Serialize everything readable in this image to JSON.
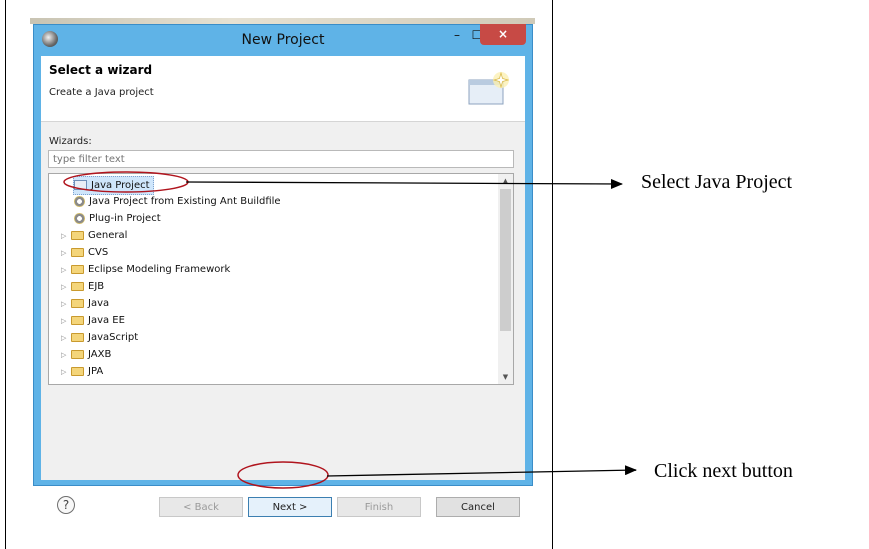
{
  "window": {
    "title": "New Project",
    "minimize_glyph": "–",
    "maximize_glyph": "☐",
    "close_glyph": "×"
  },
  "banner": {
    "title": "Select a wizard",
    "description": "Create a Java project"
  },
  "wizards": {
    "label": "Wizards:",
    "filter_placeholder": "type filter text",
    "items": [
      {
        "label": "Java Project",
        "icon": "java-project-icon"
      },
      {
        "label": "Java Project from Existing Ant Buildfile",
        "icon": "ant-project-icon"
      },
      {
        "label": "Plug-in Project",
        "icon": "plugin-project-icon"
      },
      {
        "label": "General",
        "icon": "folder-icon"
      },
      {
        "label": "CVS",
        "icon": "folder-icon"
      },
      {
        "label": "Eclipse Modeling Framework",
        "icon": "folder-icon"
      },
      {
        "label": "EJB",
        "icon": "folder-icon"
      },
      {
        "label": "Java",
        "icon": "folder-icon"
      },
      {
        "label": "Java EE",
        "icon": "folder-icon"
      },
      {
        "label": "JavaScript",
        "icon": "folder-icon"
      },
      {
        "label": "JAXB",
        "icon": "folder-icon"
      },
      {
        "label": "JPA",
        "icon": "folder-icon"
      }
    ]
  },
  "buttons": {
    "help": "?",
    "back": "< Back",
    "next": "Next >",
    "finish": "Finish",
    "cancel": "Cancel"
  },
  "annotations": {
    "select": "Select Java Project",
    "click_next": "Click next button"
  },
  "colors": {
    "titlebar": "#5fb3e7",
    "close_button": "#c74a45",
    "selection": "#cfe6fb",
    "annotation_ellipse": "#b0141d"
  }
}
